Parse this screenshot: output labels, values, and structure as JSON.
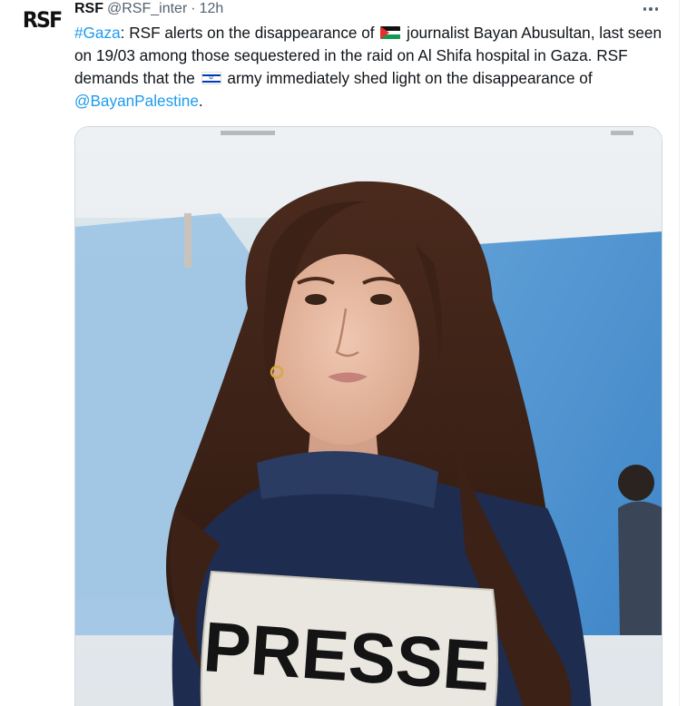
{
  "tweet": {
    "avatar_text": "RSF",
    "author_name": "RSF",
    "author_handle": "@RSF_inter",
    "separator": "·",
    "timestamp": "12h",
    "text": {
      "hashtag": "#Gaza",
      "part1": ": RSF alerts on the disappearance of",
      "flag1": "palestine-flag",
      "part2": "journalist Bayan Abusultan, last seen on 19/03 among those sequestered in the raid on Al Shifa hospital in Gaza. RSF demands that the",
      "flag2": "israel-flag",
      "part3": "army immediately shed light on the disappearance of",
      "mention": "@BayanPalestine",
      "part4": "."
    },
    "media": {
      "vest_label": "PRESSE"
    }
  },
  "colors": {
    "link": "#1d9bf0",
    "secondary_text": "#536471",
    "primary_text": "#0f1419",
    "vest_navy": "#1e2d4f",
    "press_patch": "#e9e7e0"
  }
}
